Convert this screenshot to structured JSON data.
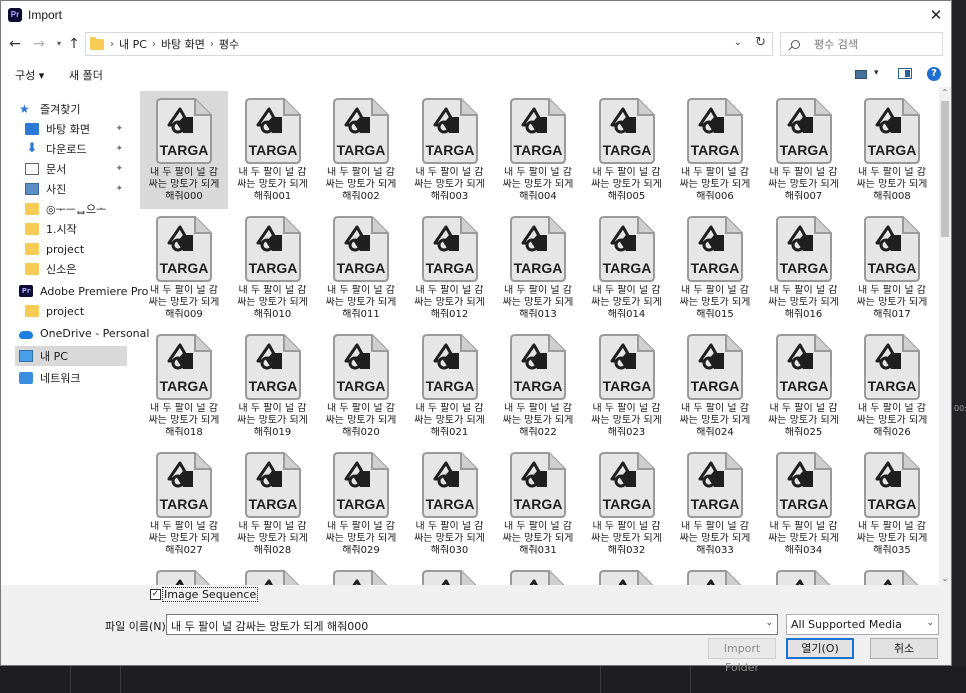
{
  "window": {
    "app_badge": "Pr",
    "title": "Import",
    "close": "✕"
  },
  "address": {
    "crumbs": [
      "내 PC",
      "바탕 화면",
      "평수"
    ]
  },
  "search": {
    "placeholder": "평수 검색"
  },
  "toolbar": {
    "organize": "구성 ▾",
    "new_folder": "새 폴더",
    "help": "?"
  },
  "nav": {
    "items": [
      {
        "label": "즐겨찾기",
        "icon": "star-icon"
      },
      {
        "label": "바탕 화면",
        "icon": "desktop-icon",
        "pinned": true
      },
      {
        "label": "다운로드",
        "icon": "download-icon",
        "pinned": true
      },
      {
        "label": "문서",
        "icon": "document-icon",
        "pinned": true
      },
      {
        "label": "사진",
        "icon": "pictures-icon",
        "pinned": true
      },
      {
        "label": "◎ᅮᅳᆸ으ᅩ",
        "icon": "folder-icon"
      },
      {
        "label": "1.시작",
        "icon": "folder-icon"
      },
      {
        "label": "project",
        "icon": "folder-icon"
      },
      {
        "label": "신소은",
        "icon": "folder-icon"
      },
      {
        "label": "Adobe Premiere Pro",
        "icon": "premiere-icon"
      },
      {
        "label": "project",
        "icon": "folder-icon"
      },
      {
        "label": "OneDrive - Personal",
        "icon": "onedrive-icon"
      },
      {
        "label": "내 PC",
        "icon": "pc-icon",
        "selected": true
      },
      {
        "label": "네트워크",
        "icon": "network-icon"
      }
    ]
  },
  "files": {
    "badge": "TARGA",
    "line1": "내 두 팔이 널 감",
    "line2": "싸는 망토가 되게",
    "names": [
      "해줘000",
      "해줘001",
      "해줘002",
      "해줘003",
      "해줘004",
      "해줘005",
      "해줘006",
      "해줘007",
      "해줘008",
      "해줘009",
      "해줘010",
      "해줘011",
      "해줘012",
      "해줘013",
      "해줘014",
      "해줘015",
      "해줘016",
      "해줘017",
      "해줘018",
      "해줘019",
      "해줘020",
      "해줘021",
      "해줘022",
      "해줘023",
      "해줘024",
      "해줘025",
      "해줘026",
      "해줘027",
      "해줘028",
      "해줘029",
      "해줘030",
      "해줘031",
      "해줘032",
      "해줘033",
      "해줘034",
      "해줘035"
    ],
    "selected_index": 0
  },
  "bottom": {
    "image_sequence_label": "Image Sequence",
    "image_sequence_checked": true,
    "filename_label": "파일 이름(N):",
    "filename_value": "내 두 팔이 널 감싸는 망토가 되게 해줘000",
    "filetype_value": "All Supported Media",
    "import_folder": "Import Folder",
    "open": "열기(O)",
    "cancel": "취소"
  },
  "background": {
    "timecode": "00:0"
  }
}
